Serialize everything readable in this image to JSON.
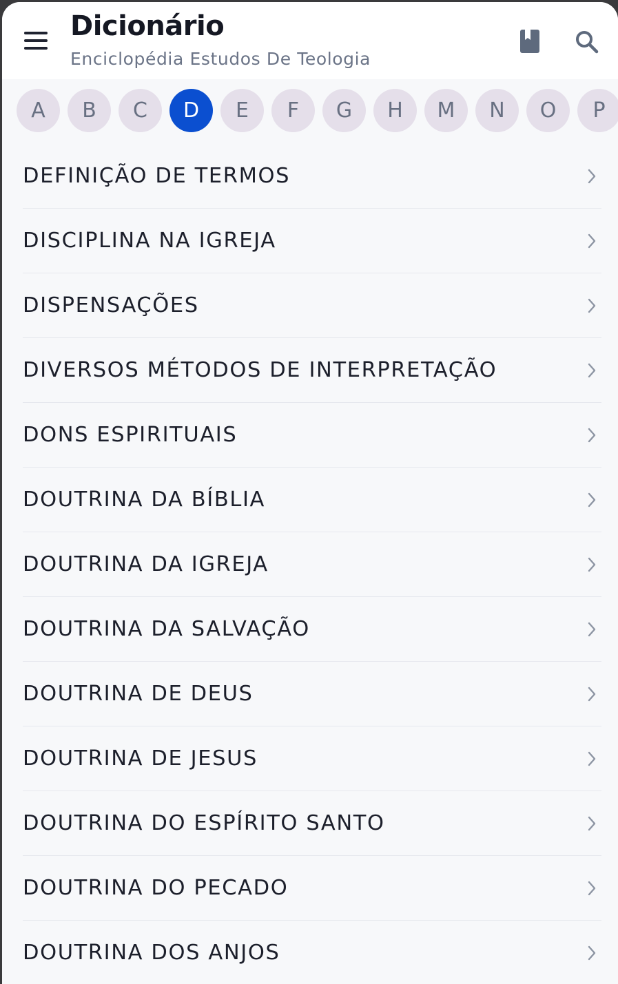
{
  "header": {
    "title": "Dicionário",
    "subtitle": "Enciclopédia Estudos De Teologia",
    "icons": [
      "menu-icon",
      "book-icon",
      "search-icon"
    ]
  },
  "letters": {
    "items": [
      "A",
      "B",
      "C",
      "D",
      "E",
      "F",
      "G",
      "H",
      "M",
      "N",
      "O",
      "P"
    ],
    "selected": "D"
  },
  "entries": [
    "DEFINIÇÃO DE TERMOS",
    "DISCIPLINA NA IGREJA",
    "DISPENSAÇÕES",
    "DIVERSOS MÉTODOS DE INTERPRETAÇÃO",
    "DONS ESPIRITUAIS",
    "DOUTRINA DA BÍBLIA",
    "DOUTRINA DA IGREJA",
    "DOUTRINA DA SALVAÇÃO",
    "DOUTRINA DE DEUS",
    "DOUTRINA DE JESUS",
    "DOUTRINA DO ESPÍRITO SANTO",
    "DOUTRINA DO PECADO",
    "DOUTRINA DOS ANJOS"
  ],
  "colors": {
    "accent": "#0b4fd0",
    "chip": "#e5dfea",
    "background": "#f7f8fa",
    "text": "#1c1f2b",
    "subtitle": "#6b7487"
  }
}
